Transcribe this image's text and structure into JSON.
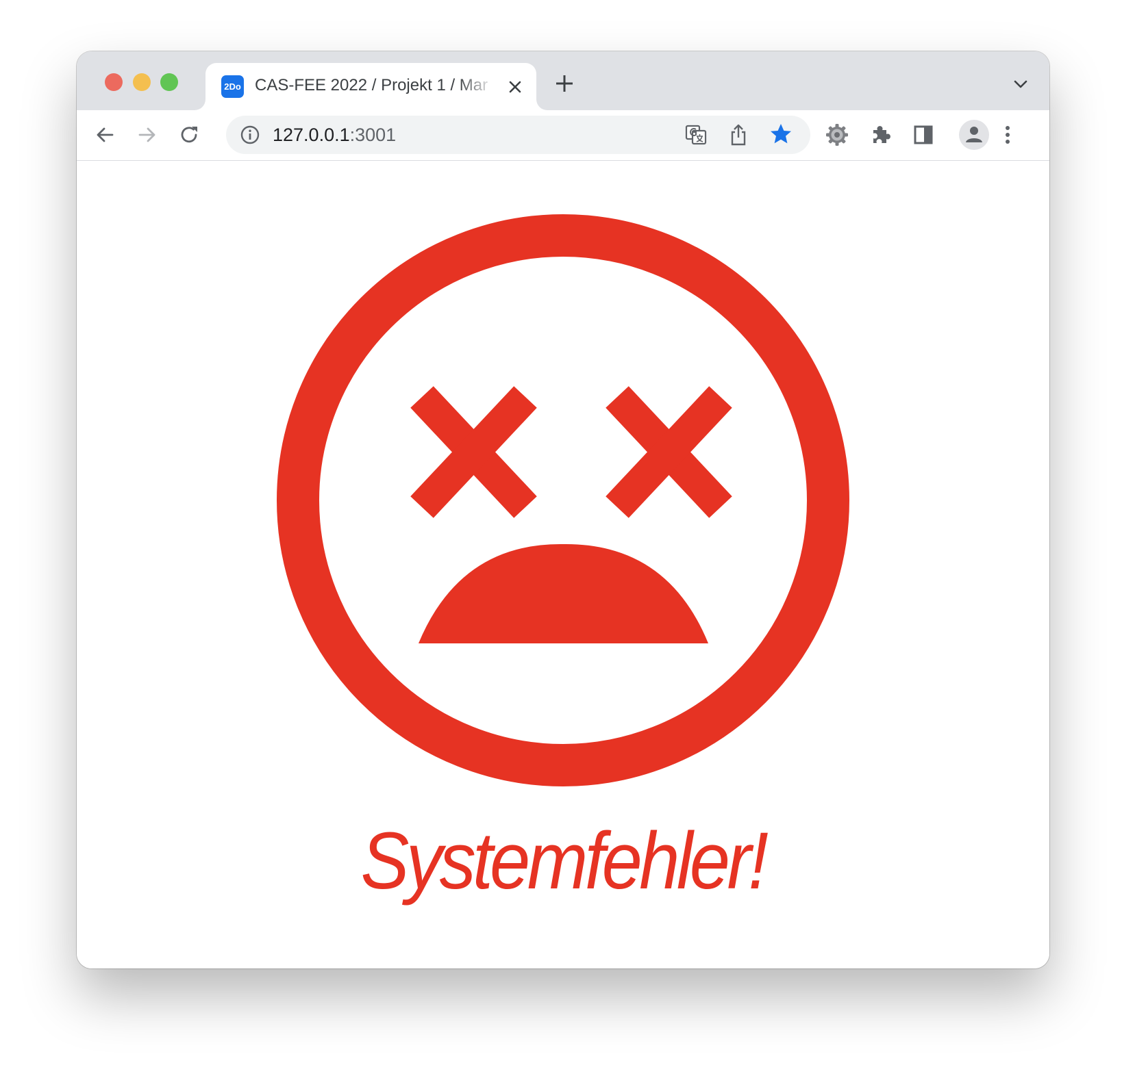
{
  "browser": {
    "tab": {
      "favicon_text": "2Do",
      "title": "CAS-FEE 2022 / Projekt 1 / Mar"
    },
    "address": {
      "host": "127.0.0.1",
      "port": ":3001"
    }
  },
  "page": {
    "error_message": "Systemfehler!",
    "accent_color": "#e63323"
  },
  "icons": {
    "back": "arrow-left-icon",
    "forward": "arrow-right-icon",
    "reload": "reload-icon",
    "site_info": "info-icon",
    "translate": "translate-icon",
    "share": "share-icon",
    "bookmark": "star-icon",
    "extension_settings": "gear-icon",
    "extensions": "puzzle-icon",
    "side_panel": "side-panel-icon",
    "profile": "profile-icon",
    "menu": "kebab-menu-icon"
  }
}
